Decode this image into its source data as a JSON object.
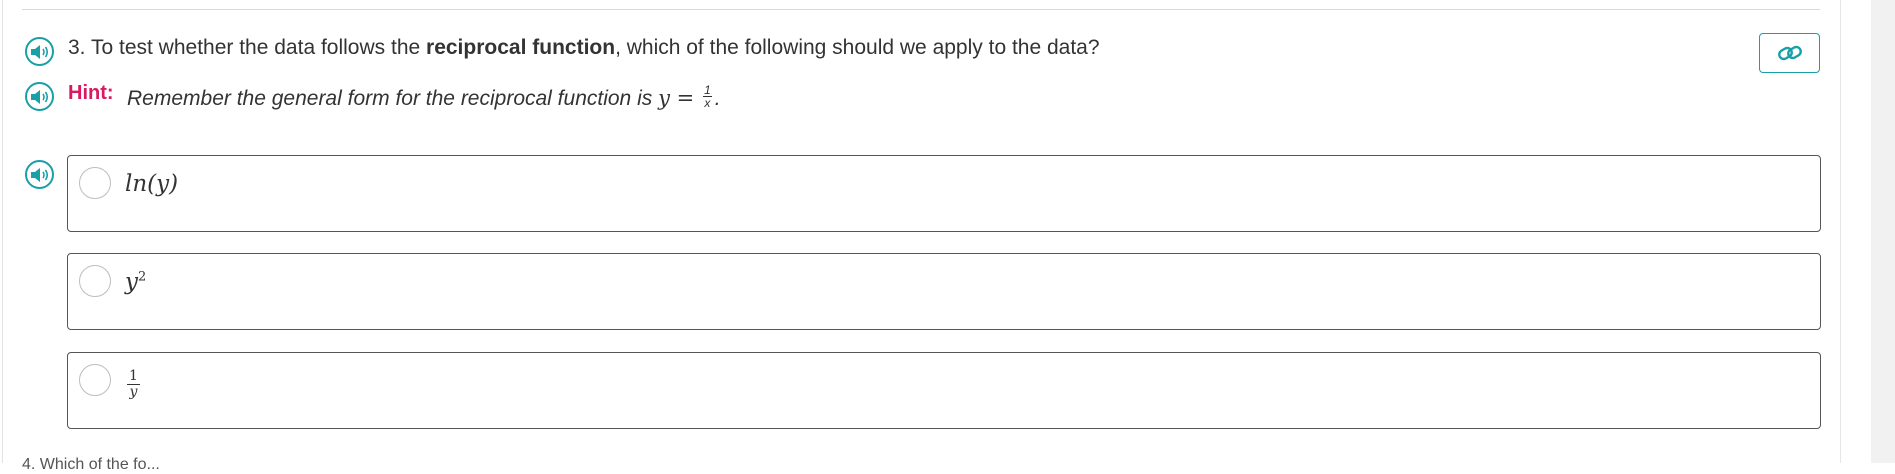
{
  "question": {
    "number": "3.",
    "text_before": "To test whether the data follows the",
    "text_bold": "reciprocal function",
    "text_after": ", which of the following should we apply to the data?"
  },
  "hint": {
    "label": "Hint:",
    "text": "Remember the general form for the reciprocal function is",
    "formula_lhs": "y =",
    "formula_num": "1",
    "formula_den": "x",
    "formula_end": "."
  },
  "options": [
    {
      "label": "ln(y)"
    },
    {
      "label_base": "y",
      "label_sup": "2"
    },
    {
      "frac_num": "1",
      "frac_den": "y"
    }
  ],
  "icons": {
    "speaker": "speaker-icon",
    "link": "link-icon"
  },
  "colors": {
    "accent": "#199fa6",
    "hint": "#d81b60",
    "border": "#555555"
  },
  "next_question_cutoff": "4. Which of the fo..."
}
